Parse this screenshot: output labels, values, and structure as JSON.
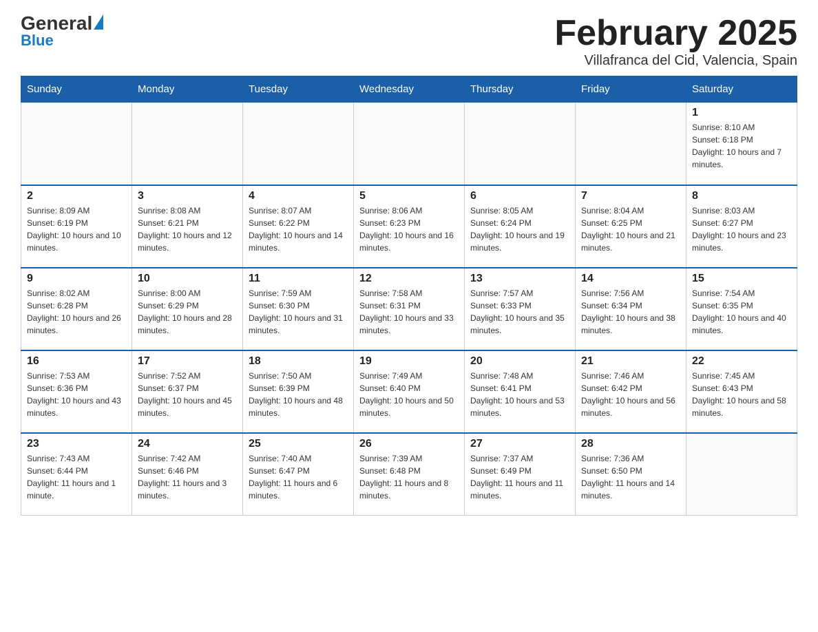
{
  "header": {
    "logo_general": "General",
    "logo_blue": "Blue",
    "title": "February 2025",
    "subtitle": "Villafranca del Cid, Valencia, Spain"
  },
  "weekdays": [
    "Sunday",
    "Monday",
    "Tuesday",
    "Wednesday",
    "Thursday",
    "Friday",
    "Saturday"
  ],
  "weeks": [
    [
      {
        "day": "",
        "info": ""
      },
      {
        "day": "",
        "info": ""
      },
      {
        "day": "",
        "info": ""
      },
      {
        "day": "",
        "info": ""
      },
      {
        "day": "",
        "info": ""
      },
      {
        "day": "",
        "info": ""
      },
      {
        "day": "1",
        "info": "Sunrise: 8:10 AM\nSunset: 6:18 PM\nDaylight: 10 hours and 7 minutes."
      }
    ],
    [
      {
        "day": "2",
        "info": "Sunrise: 8:09 AM\nSunset: 6:19 PM\nDaylight: 10 hours and 10 minutes."
      },
      {
        "day": "3",
        "info": "Sunrise: 8:08 AM\nSunset: 6:21 PM\nDaylight: 10 hours and 12 minutes."
      },
      {
        "day": "4",
        "info": "Sunrise: 8:07 AM\nSunset: 6:22 PM\nDaylight: 10 hours and 14 minutes."
      },
      {
        "day": "5",
        "info": "Sunrise: 8:06 AM\nSunset: 6:23 PM\nDaylight: 10 hours and 16 minutes."
      },
      {
        "day": "6",
        "info": "Sunrise: 8:05 AM\nSunset: 6:24 PM\nDaylight: 10 hours and 19 minutes."
      },
      {
        "day": "7",
        "info": "Sunrise: 8:04 AM\nSunset: 6:25 PM\nDaylight: 10 hours and 21 minutes."
      },
      {
        "day": "8",
        "info": "Sunrise: 8:03 AM\nSunset: 6:27 PM\nDaylight: 10 hours and 23 minutes."
      }
    ],
    [
      {
        "day": "9",
        "info": "Sunrise: 8:02 AM\nSunset: 6:28 PM\nDaylight: 10 hours and 26 minutes."
      },
      {
        "day": "10",
        "info": "Sunrise: 8:00 AM\nSunset: 6:29 PM\nDaylight: 10 hours and 28 minutes."
      },
      {
        "day": "11",
        "info": "Sunrise: 7:59 AM\nSunset: 6:30 PM\nDaylight: 10 hours and 31 minutes."
      },
      {
        "day": "12",
        "info": "Sunrise: 7:58 AM\nSunset: 6:31 PM\nDaylight: 10 hours and 33 minutes."
      },
      {
        "day": "13",
        "info": "Sunrise: 7:57 AM\nSunset: 6:33 PM\nDaylight: 10 hours and 35 minutes."
      },
      {
        "day": "14",
        "info": "Sunrise: 7:56 AM\nSunset: 6:34 PM\nDaylight: 10 hours and 38 minutes."
      },
      {
        "day": "15",
        "info": "Sunrise: 7:54 AM\nSunset: 6:35 PM\nDaylight: 10 hours and 40 minutes."
      }
    ],
    [
      {
        "day": "16",
        "info": "Sunrise: 7:53 AM\nSunset: 6:36 PM\nDaylight: 10 hours and 43 minutes."
      },
      {
        "day": "17",
        "info": "Sunrise: 7:52 AM\nSunset: 6:37 PM\nDaylight: 10 hours and 45 minutes."
      },
      {
        "day": "18",
        "info": "Sunrise: 7:50 AM\nSunset: 6:39 PM\nDaylight: 10 hours and 48 minutes."
      },
      {
        "day": "19",
        "info": "Sunrise: 7:49 AM\nSunset: 6:40 PM\nDaylight: 10 hours and 50 minutes."
      },
      {
        "day": "20",
        "info": "Sunrise: 7:48 AM\nSunset: 6:41 PM\nDaylight: 10 hours and 53 minutes."
      },
      {
        "day": "21",
        "info": "Sunrise: 7:46 AM\nSunset: 6:42 PM\nDaylight: 10 hours and 56 minutes."
      },
      {
        "day": "22",
        "info": "Sunrise: 7:45 AM\nSunset: 6:43 PM\nDaylight: 10 hours and 58 minutes."
      }
    ],
    [
      {
        "day": "23",
        "info": "Sunrise: 7:43 AM\nSunset: 6:44 PM\nDaylight: 11 hours and 1 minute."
      },
      {
        "day": "24",
        "info": "Sunrise: 7:42 AM\nSunset: 6:46 PM\nDaylight: 11 hours and 3 minutes."
      },
      {
        "day": "25",
        "info": "Sunrise: 7:40 AM\nSunset: 6:47 PM\nDaylight: 11 hours and 6 minutes."
      },
      {
        "day": "26",
        "info": "Sunrise: 7:39 AM\nSunset: 6:48 PM\nDaylight: 11 hours and 8 minutes."
      },
      {
        "day": "27",
        "info": "Sunrise: 7:37 AM\nSunset: 6:49 PM\nDaylight: 11 hours and 11 minutes."
      },
      {
        "day": "28",
        "info": "Sunrise: 7:36 AM\nSunset: 6:50 PM\nDaylight: 11 hours and 14 minutes."
      },
      {
        "day": "",
        "info": ""
      }
    ]
  ]
}
